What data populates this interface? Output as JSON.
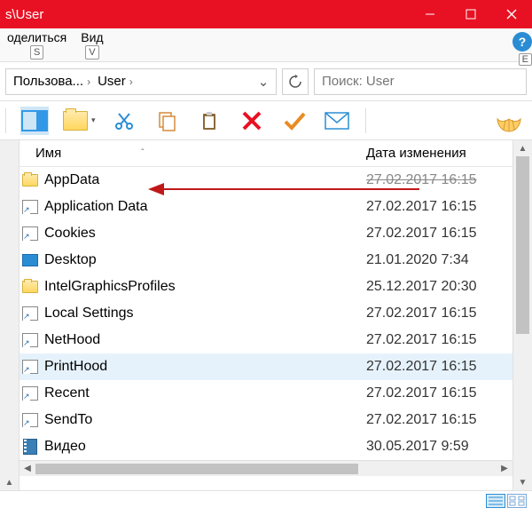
{
  "window": {
    "title": "s\\User"
  },
  "menu": {
    "share": {
      "label": "оделиться",
      "key": "S"
    },
    "view": {
      "label": "Вид",
      "key": "V"
    },
    "help": {
      "label": "?",
      "key": "Е"
    }
  },
  "address": {
    "seg1": "Пользова...",
    "seg2": "User"
  },
  "search": {
    "placeholder": "Поиск: User"
  },
  "columns": {
    "name": "Имя",
    "date": "Дата изменения"
  },
  "rows": [
    {
      "icon": "folder",
      "name": "AppData",
      "date": "27.02.2017 16:15",
      "highlight": true
    },
    {
      "icon": "shortcut",
      "name": "Application Data",
      "date": "27.02.2017 16:15"
    },
    {
      "icon": "shortcut",
      "name": "Cookies",
      "date": "27.02.2017 16:15"
    },
    {
      "icon": "desktop",
      "name": "Desktop",
      "date": "21.01.2020 7:34"
    },
    {
      "icon": "folder",
      "name": "IntelGraphicsProfiles",
      "date": "25.12.2017 20:30"
    },
    {
      "icon": "shortcut",
      "name": "Local Settings",
      "date": "27.02.2017 16:15"
    },
    {
      "icon": "shortcut",
      "name": "NetHood",
      "date": "27.02.2017 16:15"
    },
    {
      "icon": "shortcut",
      "name": "PrintHood",
      "date": "27.02.2017 16:15",
      "selected": true
    },
    {
      "icon": "shortcut",
      "name": "Recent",
      "date": "27.02.2017 16:15"
    },
    {
      "icon": "shortcut",
      "name": "SendTo",
      "date": "27.02.2017 16:15"
    },
    {
      "icon": "video",
      "name": "Видео",
      "date": "30.05.2017 9:59"
    }
  ]
}
